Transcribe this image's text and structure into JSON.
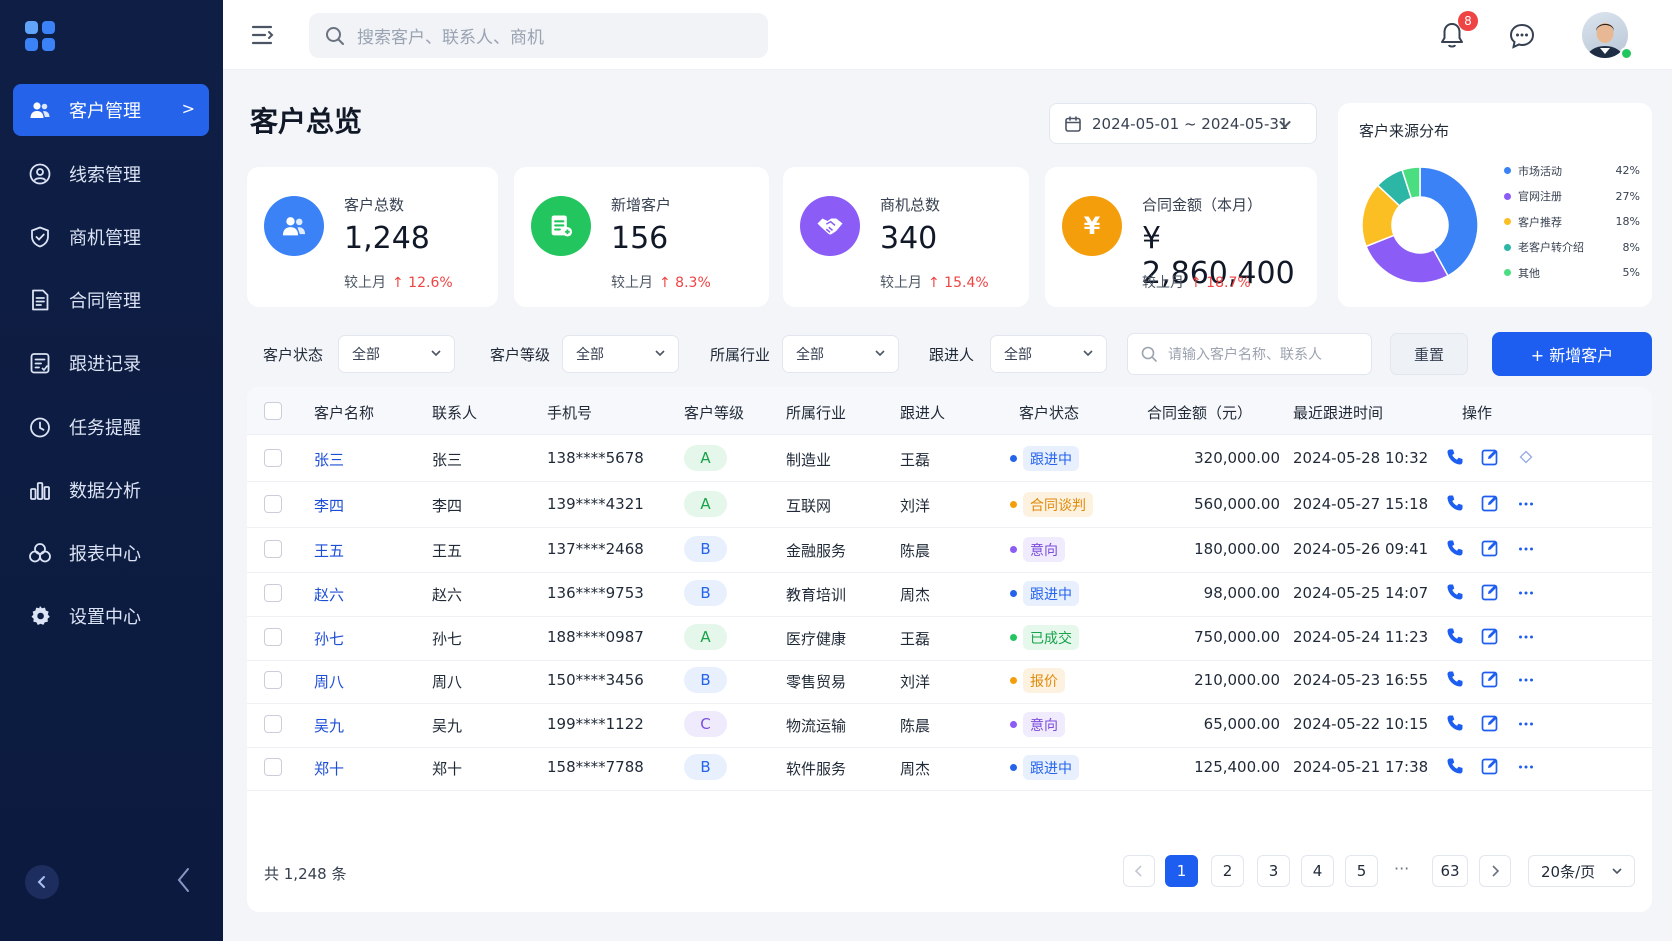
{
  "app": {
    "brand_color": "#2563eb"
  },
  "sidebar": {
    "items": [
      {
        "label": "客户管理",
        "icon": "users-icon"
      },
      {
        "label": "线索管理",
        "icon": "lead-icon"
      },
      {
        "label": "商机管理",
        "icon": "shield-check-icon"
      },
      {
        "label": "合同管理",
        "icon": "document-icon"
      },
      {
        "label": "跟进记录",
        "icon": "followup-icon"
      },
      {
        "label": "任务提醒",
        "icon": "clock-icon"
      },
      {
        "label": "数据分析",
        "icon": "bar-chart-icon"
      },
      {
        "label": "报表中心",
        "icon": "report-icon"
      },
      {
        "label": "设置中心",
        "icon": "gear-icon"
      }
    ],
    "active_arrow": ">"
  },
  "topbar": {
    "search_placeholder": "搜索客户、联系人、商机",
    "notification_count": "8"
  },
  "page": {
    "title": "客户总览",
    "date_range": "2024-05-01 ~ 2024-05-31"
  },
  "kpis": [
    {
      "label": "客户总数",
      "value": "1,248",
      "compare_label": "较上月",
      "change": "↑ 12.6%",
      "color": "#3b82f6"
    },
    {
      "label": "新增客户",
      "value": "156",
      "compare_label": "较上月",
      "change": "↑ 8.3%",
      "color": "#22c55e"
    },
    {
      "label": "商机总数",
      "value": "340",
      "compare_label": "较上月",
      "change": "↑ 15.4%",
      "color": "#8b5cf6"
    },
    {
      "label": "合同金额（本月）",
      "value": "¥ 2,860,400",
      "compare_label": "较上月",
      "change": "↑ 18.7%",
      "color": "#f59e0b",
      "symbol": "¥"
    }
  ],
  "source_distribution": {
    "title": "客户来源分布",
    "items": [
      {
        "name": "市场活动",
        "pct": "42%",
        "value": 42,
        "color": "#3b82f6"
      },
      {
        "name": "官网注册",
        "pct": "27%",
        "value": 27,
        "color": "#8b5cf6"
      },
      {
        "name": "客户推荐",
        "pct": "18%",
        "value": 18,
        "color": "#fbbf24"
      },
      {
        "name": "老客户转介绍",
        "pct": "8%",
        "value": 8,
        "color": "#2cb6a6"
      },
      {
        "name": "其他",
        "pct": "5%",
        "value": 5,
        "color": "#4ade80"
      }
    ]
  },
  "filters": {
    "status": {
      "label": "客户状态",
      "value": "全部"
    },
    "grade": {
      "label": "客户等级",
      "value": "全部"
    },
    "industry": {
      "label": "所属行业",
      "value": "全部"
    },
    "owner": {
      "label": "跟进人",
      "value": "全部"
    },
    "search_placeholder": "请输入客户名称、联系人",
    "reset_label": "重置",
    "add_label": "+ 新增客户"
  },
  "table": {
    "headers": [
      "客户名称",
      "联系人",
      "手机号",
      "客户等级",
      "所属行业",
      "跟进人",
      "客户状态",
      "合同金额（元）",
      "最近跟进时间",
      "操作"
    ],
    "rows": [
      {
        "name": "张三",
        "contact": "张三",
        "phone": "138****5678",
        "grade": "A",
        "industry": "制造业",
        "owner": "王磊",
        "status": "跟进中",
        "amount": "320,000.00",
        "time": "2024-05-28 10:32"
      },
      {
        "name": "李四",
        "contact": "李四",
        "phone": "139****4321",
        "grade": "A",
        "industry": "互联网",
        "owner": "刘洋",
        "status": "合同谈判",
        "amount": "560,000.00",
        "time": "2024-05-27 15:18"
      },
      {
        "name": "王五",
        "contact": "王五",
        "phone": "137****2468",
        "grade": "B",
        "industry": "金融服务",
        "owner": "陈晨",
        "status": "意向",
        "amount": "180,000.00",
        "time": "2024-05-26 09:41"
      },
      {
        "name": "赵六",
        "contact": "赵六",
        "phone": "136****9753",
        "grade": "B",
        "industry": "教育培训",
        "owner": "周杰",
        "status": "跟进中",
        "amount": "98,000.00",
        "time": "2024-05-25 14:07"
      },
      {
        "name": "孙七",
        "contact": "孙七",
        "phone": "188****0987",
        "grade": "A",
        "industry": "医疗健康",
        "owner": "王磊",
        "status": "已成交",
        "amount": "750,000.00",
        "time": "2024-05-24 11:23"
      },
      {
        "name": "周八",
        "contact": "周八",
        "phone": "150****3456",
        "grade": "B",
        "industry": "零售贸易",
        "owner": "刘洋",
        "status": "报价",
        "amount": "210,000.00",
        "time": "2024-05-23 16:55"
      },
      {
        "name": "吴九",
        "contact": "吴九",
        "phone": "199****1122",
        "grade": "C",
        "industry": "物流运输",
        "owner": "陈晨",
        "status": "意向",
        "amount": "65,000.00",
        "time": "2024-05-22 10:15"
      },
      {
        "name": "郑十",
        "contact": "郑十",
        "phone": "158****7788",
        "grade": "B",
        "industry": "软件服务",
        "owner": "周杰",
        "status": "跟进中",
        "amount": "125,400.00",
        "time": "2024-05-21 17:38"
      }
    ]
  },
  "status_colors": {
    "跟进中": {
      "dot": "#2563eb",
      "bg": "#e8f0fe",
      "fg": "#2563eb"
    },
    "合同谈判": {
      "dot": "#f59e0b",
      "bg": "#fdf2e0",
      "fg": "#e08a0b"
    },
    "意向": {
      "dot": "#8b5cf6",
      "bg": "#f0ebfd",
      "fg": "#7c4ddc"
    },
    "已成交": {
      "dot": "#22c55e",
      "bg": "#e6f7ec",
      "fg": "#16a34a"
    },
    "报价": {
      "dot": "#f59e0b",
      "bg": "#fdf2e0",
      "fg": "#e08a0b"
    }
  },
  "grade_colors": {
    "A": {
      "bg": "#e5f6ea",
      "fg": "#16a34a"
    },
    "B": {
      "bg": "#e8f0fe",
      "fg": "#2563eb"
    },
    "C": {
      "bg": "#efeafc",
      "fg": "#7c4ddc"
    }
  },
  "pagination": {
    "total": "共 1,248 条",
    "pages": [
      "1",
      "2",
      "3",
      "4",
      "5"
    ],
    "ellipsis": "···",
    "last_page": "63",
    "current": "1",
    "page_size": "20条/页"
  }
}
